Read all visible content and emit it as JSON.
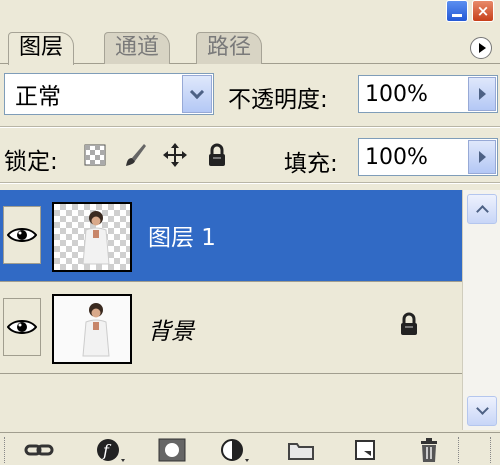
{
  "tabs": [
    {
      "label": "图层",
      "active": true
    },
    {
      "label": "通道",
      "active": false
    },
    {
      "label": "路径",
      "active": false
    }
  ],
  "blend_mode": {
    "value": "正常"
  },
  "opacity": {
    "label": "不透明度:",
    "value": "100%"
  },
  "lock": {
    "label": "锁定:",
    "icons": [
      "lock-transparent-icon",
      "lock-brush-icon",
      "lock-move-icon",
      "lock-all-icon"
    ]
  },
  "fill": {
    "label": "填充:",
    "value": "100%"
  },
  "layers": [
    {
      "name": "图层 1",
      "selected": true,
      "visible": true,
      "locked": false
    },
    {
      "name": "背景",
      "selected": false,
      "visible": true,
      "locked": true
    }
  ],
  "bottom_toolbar": [
    "link-icon",
    "layer-style-icon",
    "mask-icon",
    "adjustment-layer-icon",
    "group-folder-icon",
    "new-layer-icon",
    "trash-icon"
  ],
  "colors": {
    "selection": "#316ac5",
    "panel": "#ece9d8",
    "accent_border": "#7f9db9"
  }
}
